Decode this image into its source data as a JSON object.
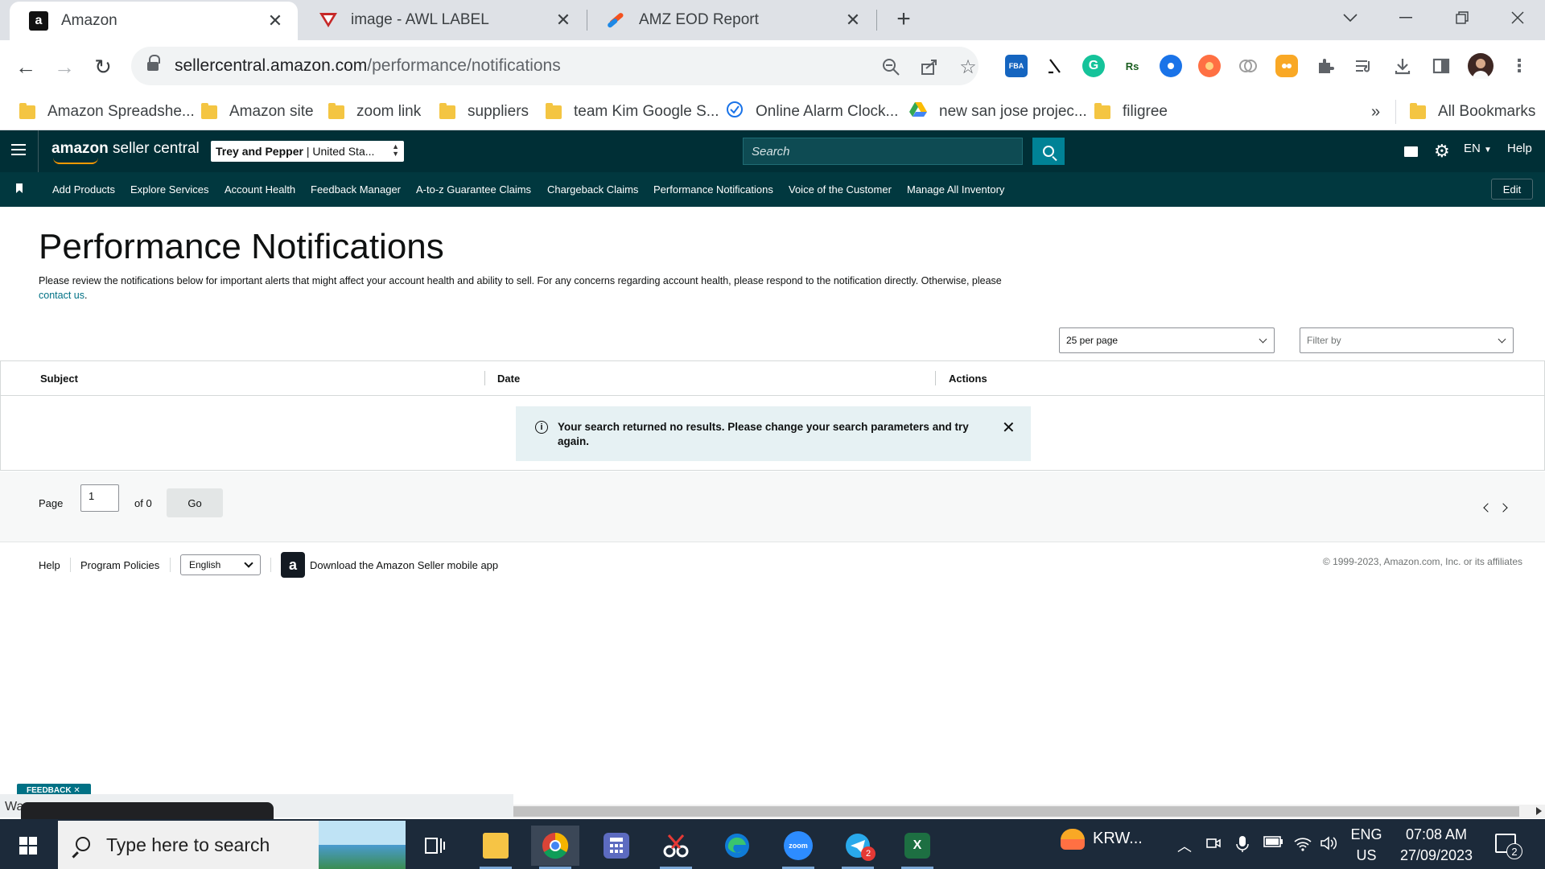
{
  "browser": {
    "tabs": [
      {
        "title": "Amazon",
        "favicon": "amazon-a-icon"
      },
      {
        "title": "image - AWL LABEL",
        "favicon": "awl-logo-icon"
      },
      {
        "title": "AMZ EOD Report",
        "favicon": "report-logo-icon"
      }
    ],
    "url_host": "sellercentral.amazon.com",
    "url_path": "/performance/notifications",
    "bookmarks": [
      "Amazon Spreadshe...",
      "Amazon site",
      "zoom link",
      "suppliers",
      "team Kim Google S...",
      "Online Alarm Clock...",
      "new san jose projec...",
      "filigree"
    ],
    "more_bookmarks": "»",
    "all_bookmarks": "All Bookmarks",
    "extensions": {
      "fba_label": "FBA",
      "rs_label": "Rs"
    }
  },
  "seller_central": {
    "logo_brand": "amazon",
    "logo_product": "seller central",
    "account_name": "Trey and Pepper",
    "account_market": "United Sta...",
    "search_placeholder": "Search",
    "language": "EN",
    "help": "Help",
    "nav_links": [
      "Add Products",
      "Explore Services",
      "Account Health",
      "Feedback Manager",
      "A-to-z Guarantee Claims",
      "Chargeback Claims",
      "Performance Notifications",
      "Voice of the Customer",
      "Manage All Inventory"
    ],
    "edit_label": "Edit"
  },
  "page": {
    "title": "Performance Notifications",
    "intro_text": "Please review the notifications below for important alerts that might affect your account health and ability to sell. For any concerns regarding account health, please respond to the notification directly. Otherwise, please ",
    "contact_link": "contact us",
    "intro_end": ".",
    "per_page": "25 per page",
    "filter_placeholder": "Filter by",
    "columns": [
      "Subject",
      "Date",
      "Actions"
    ],
    "no_results": "Your search returned no results. Please change your search parameters and try again.",
    "info_glyph": "i",
    "close_glyph": "✕",
    "pager": {
      "page_label": "Page",
      "page_value": "1",
      "of_label": "of 0",
      "go_label": "Go"
    }
  },
  "footer": {
    "help": "Help",
    "program_policies": "Program Policies",
    "language": "English",
    "app_link": "Download the Amazon Seller mobile app",
    "copyright": "© 1999-2023, Amazon.com, Inc. or its affiliates"
  },
  "feedback_tab": "FEEDBACK ✕",
  "popup_text": "Wa",
  "taskbar": {
    "search_placeholder": "Type here to search",
    "weather": "KRW...",
    "telegram_badge": "2",
    "zoom_label": "zoom",
    "excel_label": "X",
    "lang_top": "ENG",
    "lang_bottom": "US",
    "time": "07:08 AM",
    "date": "27/09/2023",
    "notification_count": "2"
  }
}
